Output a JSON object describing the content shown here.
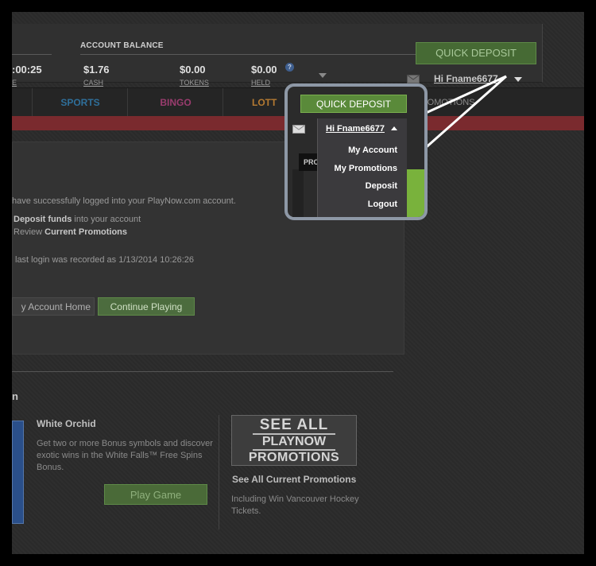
{
  "header": {
    "timer_value": ":00:25",
    "timer_label": "E",
    "account_balance_title": "ACCOUNT BALANCE",
    "balances": [
      {
        "value": "$1.76",
        "label": "CASH"
      },
      {
        "value": "$0.00",
        "label": "TOKENS"
      },
      {
        "value": "$0.00",
        "label": "HELD"
      }
    ],
    "help_glyph": "?",
    "quick_deposit_label": "QUICK DEPOSIT",
    "greeting": "Hi Fname6677"
  },
  "nav": {
    "items": [
      {
        "label": "SPORTS",
        "color": "#2f6f9a"
      },
      {
        "label": "BINGO",
        "color": "#9a3c6e"
      },
      {
        "label": "LOTT",
        "color": "#b57a32"
      },
      {
        "label": "PROMOTIONS",
        "color": "#8a8a8a"
      }
    ]
  },
  "welcome": {
    "line1": "have successfully logged into your PlayNow.com account.",
    "line2_bold": "Deposit funds",
    "line2_rest": " into your account",
    "line3_prefix": "Review ",
    "line3_bold": "Current Promotions",
    "line4": "last login was recorded as ",
    "last_login": "1/13/2014 10:26:26",
    "account_home_label": "y Account Home",
    "continue_playing_label": "Continue Playing"
  },
  "featured": {
    "section_title": "n",
    "game_title": "White Orchid",
    "game_description": "Get two or more Bonus symbols and discover exotic wins in the White Falls™ Free Spins Bonus.",
    "play_game_label": "Play Game",
    "promo_image_lines": [
      "SEE ALL",
      "PLAYNOW",
      "PROMOTIONS"
    ],
    "promo_title": "See All Current Promotions",
    "promo_description": "Including Win Vancouver Hockey Tickets."
  },
  "callout": {
    "quick_deposit_label": "QUICK DEPOSIT",
    "greeting": "Hi Fname6677",
    "promo_fragment": "PROM",
    "menu_items": [
      "My Account",
      "My Promotions",
      "Deposit",
      "Logout"
    ]
  },
  "colors": {
    "accent_green": "#5a8a3a",
    "alert_red": "#7a2a2e",
    "callout_border": "#8e98a6"
  },
  "icons": [
    "mail-icon",
    "chevron-down-icon",
    "chevron-up-icon",
    "help-icon"
  ]
}
